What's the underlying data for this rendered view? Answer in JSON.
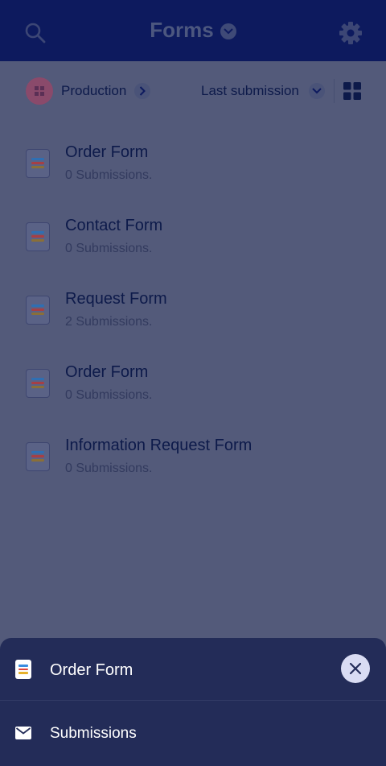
{
  "header": {
    "title": "Forms",
    "icons": [
      "search-icon",
      "chevron-down-icon",
      "gear-icon"
    ]
  },
  "filters": {
    "workspace": "Production",
    "sort": "Last submission",
    "icons": [
      "avatar",
      "chevron-right-icon",
      "chevron-down-icon",
      "grid-view-icon"
    ]
  },
  "forms": [
    {
      "name": "Order Form",
      "submissions": "0 Submissions."
    },
    {
      "name": "Contact Form",
      "submissions": "0 Submissions."
    },
    {
      "name": "Request Form",
      "submissions": "2 Submissions."
    },
    {
      "name": "Order Form",
      "submissions": "0 Submissions."
    },
    {
      "name": "Information Request Form",
      "submissions": "0 Submissions."
    }
  ],
  "sheet": {
    "title": "Order Form",
    "option": "Submissions",
    "icons": [
      "form-doc-icon",
      "close-icon",
      "mail-icon"
    ]
  },
  "colors": {
    "overlay_background": "#535a7a",
    "header": "#0d1a5e",
    "sheet": "#232c58",
    "close_button": "#d9dcf3"
  }
}
